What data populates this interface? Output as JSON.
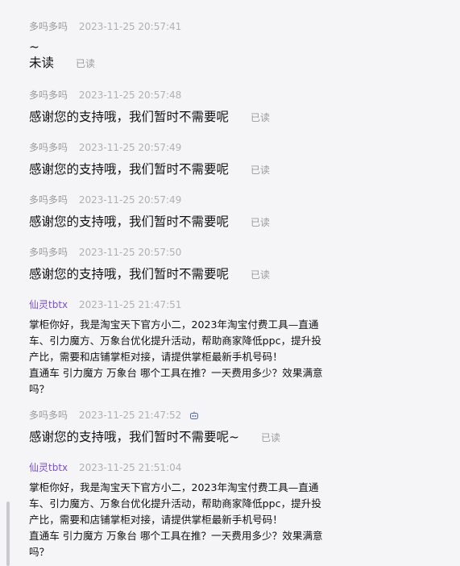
{
  "messages": [
    {
      "name": "多吗多吗",
      "time": "2023-11-25 20:57:41",
      "lines": [
        "~",
        "未读"
      ],
      "read": "已读"
    },
    {
      "name": "多吗多吗",
      "time": "2023-11-25 20:57:48",
      "text": "感谢您的支持哦，我们暂时不需要呢",
      "read": "已读"
    },
    {
      "name": "多吗多吗",
      "time": "2023-11-25 20:57:49",
      "text": "感谢您的支持哦，我们暂时不需要呢",
      "read": "已读"
    },
    {
      "name": "多吗多吗",
      "time": "2023-11-25 20:57:49",
      "text": "感谢您的支持哦，我们暂时不需要呢",
      "read": "已读"
    },
    {
      "name": "多吗多吗",
      "time": "2023-11-25 20:57:50",
      "text": "感谢您的支持哦，我们暂时不需要呢",
      "read": "已读"
    },
    {
      "name": "仙灵tbtx",
      "time": "2023-11-25 21:47:51",
      "lines": [
        "掌柜你好，我是淘宝天下官方小二，2023年淘宝付费工具—直通",
        "车、引力魔方、万象台优化提升活动，帮助商家降低ppc，提升投",
        "产比，需要和店铺掌柜对接，请提供掌柜最新手机号码！",
        "直通车 引力魔方 万象台 哪个工具在推？一天费用多少？效果满意",
        "吗？"
      ]
    },
    {
      "name": "多吗多吗",
      "time": "2023-11-25 21:47:52",
      "text": "感谢您的支持哦，我们暂时不需要呢~",
      "read": "已读"
    },
    {
      "name": "仙灵tbtx",
      "time": "2023-11-25 21:51:04",
      "lines": [
        "掌柜你好，我是淘宝天下官方小二，2023年淘宝付费工具—直通",
        "车、引力魔方、万象台优化提升活动，帮助商家降低ppc，提升投",
        "产比，需要和店铺掌柜对接，请提供掌柜最新手机号码！",
        "直通车 引力魔方 万象台 哪个工具在推？一天费用多少？效果满意",
        "吗？"
      ]
    }
  ]
}
